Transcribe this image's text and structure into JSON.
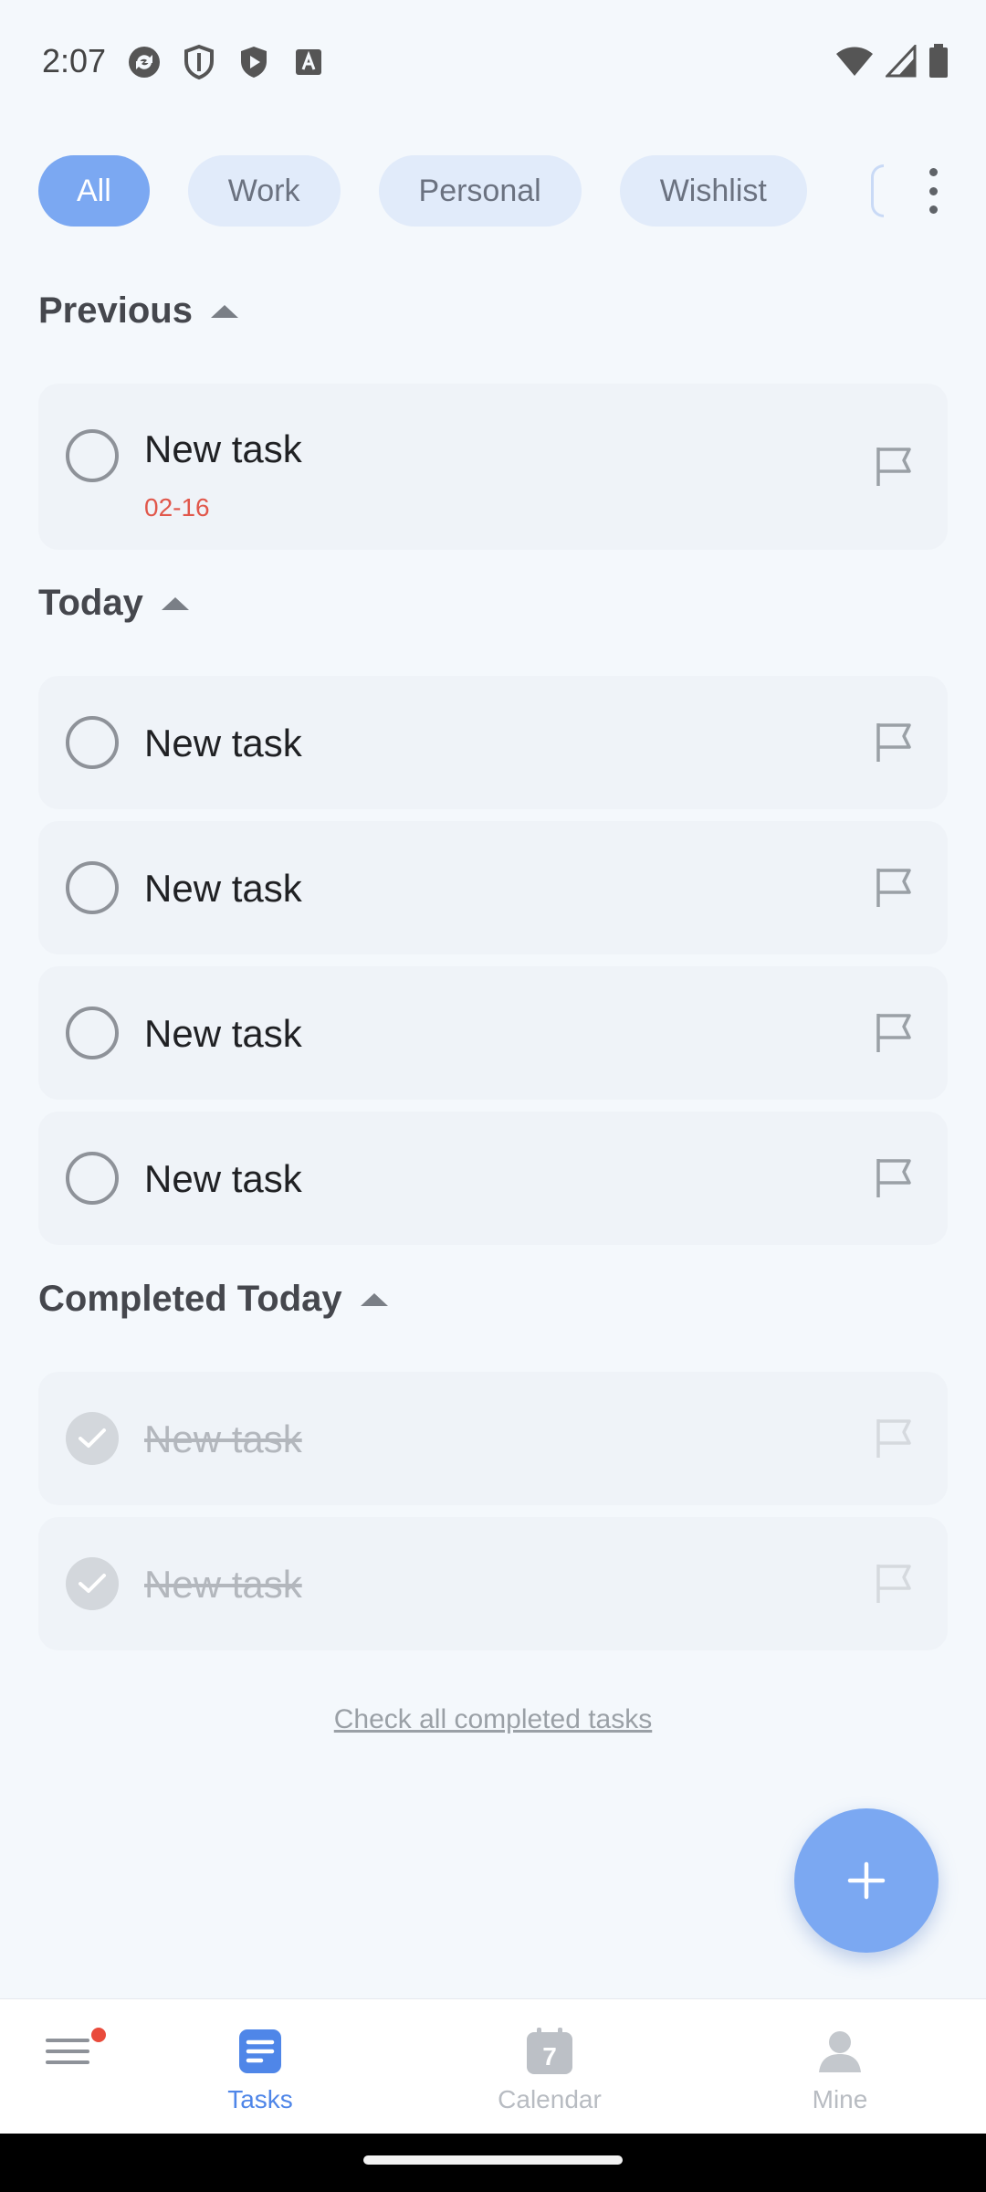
{
  "status_bar": {
    "time": "2:07",
    "left_icons": [
      "sync-icon",
      "shield-icon",
      "play-shield-icon",
      "font-a-icon"
    ],
    "right_icons": [
      "wifi-icon",
      "signal-icon",
      "battery-icon"
    ]
  },
  "filters": {
    "chips": [
      "All",
      "Work",
      "Personal",
      "Wishlist"
    ],
    "active": "All",
    "more_icon": "more-vertical-icon"
  },
  "sections": {
    "previous": {
      "title": "Previous",
      "tasks": [
        {
          "title": "New task",
          "date": "02-16"
        }
      ]
    },
    "today": {
      "title": "Today",
      "tasks": [
        {
          "title": "New task"
        },
        {
          "title": "New task"
        },
        {
          "title": "New task"
        },
        {
          "title": "New task"
        }
      ]
    },
    "completed_today": {
      "title": "Completed Today",
      "tasks": [
        {
          "title": "New task"
        },
        {
          "title": "New task"
        }
      ]
    }
  },
  "check_all_link": "Check all completed tasks",
  "fab": {
    "icon": "plus-icon"
  },
  "bottom_nav": {
    "items": [
      {
        "label": "",
        "icon": "menu-icon"
      },
      {
        "label": "Tasks",
        "icon": "tasks-icon",
        "active": true
      },
      {
        "label": "Calendar",
        "icon": "calendar-icon",
        "day": "7"
      },
      {
        "label": "Mine",
        "icon": "person-icon"
      }
    ]
  },
  "colors": {
    "accent": "#7BA8F2",
    "active_nav": "#4F86E8",
    "overdue_date": "#E1574B",
    "background": "#F4F8FC",
    "card": "#EFF3F8"
  }
}
